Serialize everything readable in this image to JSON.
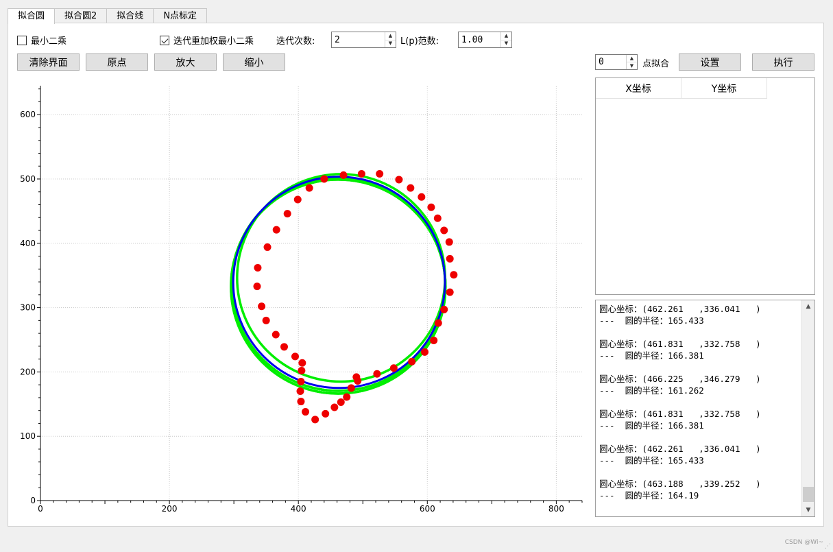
{
  "tabs": [
    "拟合圆",
    "拟合圆2",
    "拟合线",
    "N点标定"
  ],
  "active_tab": 0,
  "options": {
    "least_squares_label": "最小二乘",
    "least_squares_checked": false,
    "irls_label": "迭代重加权最小二乘",
    "irls_checked": true,
    "iterations_label": "迭代次数:",
    "iterations_value": "2",
    "lp_label": "L(p)范数:",
    "lp_value": "1.00"
  },
  "toolbar": {
    "clear_label": "清除界面",
    "origin_label": "原点",
    "zoom_in_label": "放大",
    "zoom_out_label": "缩小"
  },
  "fit_controls": {
    "points_value": "0",
    "points_label": "点拟合",
    "settings_label": "设置",
    "execute_label": "执行"
  },
  "table": {
    "headers": [
      "X坐标",
      "Y坐标"
    ]
  },
  "log": [
    {
      "line1": "圆心坐标：(462.261   ,336.041   )",
      "line2": "---  圆的半径：165.433"
    },
    {
      "line1": "圆心坐标：(461.831   ,332.758   )",
      "line2": "---  圆的半径：166.381"
    },
    {
      "line1": "圆心坐标：(466.225   ,346.279   )",
      "line2": "---  圆的半径：161.262"
    },
    {
      "line1": "圆心坐标：(461.831   ,332.758   )",
      "line2": "---  圆的半径：166.381"
    },
    {
      "line1": "圆心坐标：(462.261   ,336.041   )",
      "line2": "---  圆的半径：165.433"
    },
    {
      "line1": "圆心坐标：(463.188   ,339.252   )",
      "line2": "---  圆的半径：164.19"
    }
  ],
  "chart_data": {
    "type": "scatter",
    "xlim": [
      0,
      840
    ],
    "ylim": [
      0,
      645
    ],
    "x_ticks": [
      0,
      200,
      400,
      600,
      800
    ],
    "y_ticks": [
      0,
      100,
      200,
      300,
      400,
      500,
      600
    ],
    "grid": true,
    "points": [
      [
        352,
        394
      ],
      [
        366,
        421
      ],
      [
        383,
        446
      ],
      [
        399,
        468
      ],
      [
        417,
        486
      ],
      [
        440,
        500
      ],
      [
        470,
        506
      ],
      [
        498,
        508
      ],
      [
        526,
        508
      ],
      [
        556,
        499
      ],
      [
        574,
        486
      ],
      [
        591,
        472
      ],
      [
        606,
        456
      ],
      [
        616,
        439
      ],
      [
        626,
        420
      ],
      [
        634,
        402
      ],
      [
        635,
        376
      ],
      [
        641,
        351
      ],
      [
        635,
        324
      ],
      [
        626,
        297
      ],
      [
        617,
        276
      ],
      [
        610,
        249
      ],
      [
        596,
        231
      ],
      [
        576,
        216
      ],
      [
        548,
        206
      ],
      [
        522,
        197
      ],
      [
        492,
        186
      ],
      [
        490,
        192
      ],
      [
        482,
        175
      ],
      [
        475,
        161
      ],
      [
        466,
        153
      ],
      [
        456,
        145
      ],
      [
        442,
        135
      ],
      [
        426,
        126
      ],
      [
        411,
        138
      ],
      [
        404,
        154
      ],
      [
        403,
        170
      ],
      [
        404,
        185
      ],
      [
        405,
        202
      ],
      [
        406,
        214
      ],
      [
        395,
        224
      ],
      [
        378,
        239
      ],
      [
        365,
        258
      ],
      [
        350,
        280
      ],
      [
        343,
        302
      ],
      [
        336,
        333
      ],
      [
        337,
        362
      ]
    ],
    "circles": [
      {
        "color": "#00ee00",
        "cx": 462.261,
        "cy": 336.041,
        "r": 165.433
      },
      {
        "color": "#00ee00",
        "cx": 461.831,
        "cy": 332.758,
        "r": 166.381
      },
      {
        "color": "#00ee00",
        "cx": 466.225,
        "cy": 346.279,
        "r": 161.262
      },
      {
        "color": "#00ee00",
        "cx": 461.831,
        "cy": 332.758,
        "r": 166.381
      },
      {
        "color": "#00ee00",
        "cx": 462.261,
        "cy": 336.041,
        "r": 165.433
      },
      {
        "color": "#0000ee",
        "cx": 463.188,
        "cy": 339.252,
        "r": 164.19
      }
    ],
    "point_color": "#ee0000"
  },
  "watermark": "CSDN @Wi~"
}
